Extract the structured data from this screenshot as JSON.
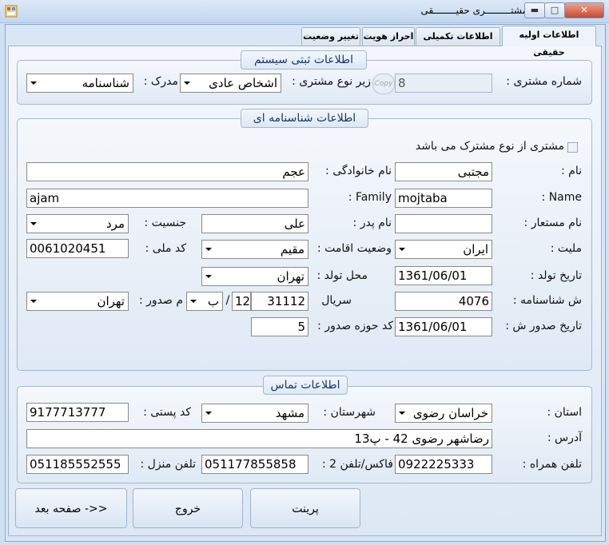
{
  "window": {
    "title": "مشتـــــــــری حقیــــــــقی",
    "min": "▬",
    "max": "□",
    "close": "✕"
  },
  "tabs": [
    "اطلاعات اولیه حقیقی",
    "اطلاعات تکمیلی حقیقی",
    "احراز هویت",
    "تغییر وضعیت"
  ],
  "system": {
    "legend": "اطلاعات ثبتی سیستم",
    "customer_no_label": "شماره مشتری :",
    "customer_no": "8",
    "copy": "Copy",
    "subtype_label": "زیر نوع مشتری :",
    "subtype": "اشخاص عادی",
    "document_label": "مدرک :",
    "document": "شناسنامه"
  },
  "identity": {
    "legend": "اطلاعات شناسنامه ای",
    "shared_check": "مشتری از نوع مشترک می باشد",
    "first_name_label": "نام :",
    "first_name": "مجتبی",
    "last_name_label": "نام خانوادگی :",
    "last_name": "عجم",
    "name_en_label": "Name :",
    "name_en": "mojtaba",
    "family_en_label": "Family :",
    "family_en": "ajam",
    "alias_label": "نام مستعار :",
    "alias": "",
    "father_label": "نام پدر :",
    "father": "علی",
    "gender_label": "جنسیت :",
    "gender": "مرد",
    "nationality_label": "ملیت :",
    "nationality": "ایران",
    "residence_label": "وضعیت اقامت :",
    "residence": "مقیم",
    "national_code_label": "کد ملی :",
    "national_code": "0061020451",
    "birth_date_label": "تاریخ تولد :",
    "birth_date": "1361/06/01",
    "birth_place_label": "محل تولد :",
    "birth_place": "تهران",
    "id_no_label": "ش شناسنامه :",
    "id_no": "4076",
    "serial_label": "سریال",
    "serial": "31112",
    "serial_num": "12",
    "serial_sep": "/",
    "serial_letter": "ب",
    "issue_place_label": "م صدور :",
    "issue_place": "تهران",
    "issue_date_label": "تاریخ صدور ش :",
    "issue_date": "1361/06/01",
    "issue_zone_label": "کد حوزه  صدور :",
    "issue_zone": "5"
  },
  "contact": {
    "legend": "اطلاعات تماس",
    "province_label": "استان :",
    "province": "خراسان رضوی",
    "city_label": "شهرستان :",
    "city": "مشهد",
    "postal_label": "کد پستی :",
    "postal": "9177713777",
    "address_label": "آدرس :",
    "address": "رضاشهر رضوی 42 - پ13",
    "mobile_label": "تلفن همراه :",
    "mobile": "0922225333",
    "fax_label": "فاکس/تلفن 2 :",
    "fax": "051177855858",
    "home_label": "تلفن منزل :",
    "home": "051185552555"
  },
  "buttons": {
    "print": "پرینت",
    "exit": "خروج",
    "next": "صفحه بعد ->>"
  },
  "colors": {
    "legend_text": "#18396b",
    "window_bg": "#d9e6f5"
  }
}
